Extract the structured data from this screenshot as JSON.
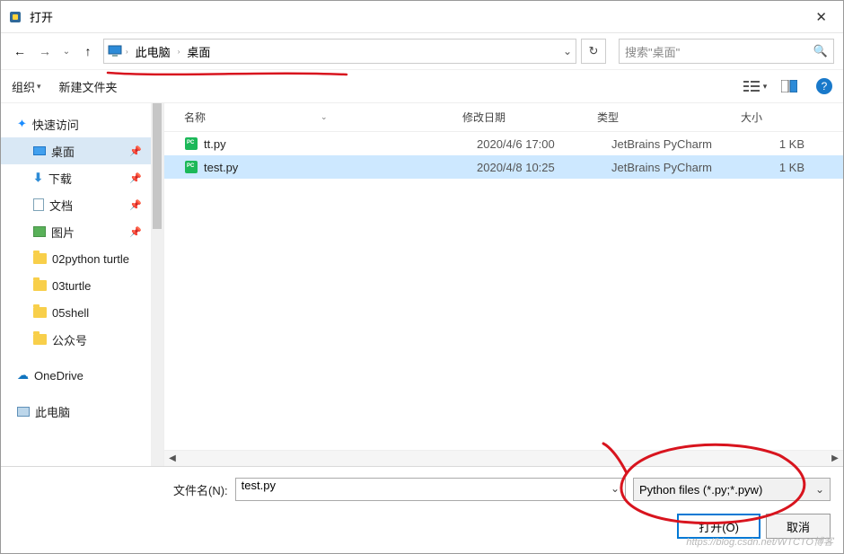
{
  "titlebar": {
    "title": "打开",
    "close_glyph": "✕"
  },
  "nav": {
    "back_glyph": "←",
    "fwd_glyph": "→",
    "up_glyph": "↑",
    "dropdown_glyph": "⌄",
    "refresh_glyph": "↻"
  },
  "breadcrumb": {
    "seg1": "此电脑",
    "seg2": "桌面",
    "sep_glyph": "›"
  },
  "search": {
    "placeholder": "搜索\"桌面\"",
    "mag_glyph": "🔍"
  },
  "toolbar": {
    "organize": "组织",
    "newfolder": "新建文件夹",
    "help_glyph": "?"
  },
  "sidebar": {
    "quick": "快速访问",
    "desktop": "桌面",
    "downloads": "下载",
    "documents": "文档",
    "pictures": "图片",
    "f1": "02python turtle",
    "f2": "03turtle",
    "f3": "05shell",
    "f4": "公众号",
    "onedrive": "OneDrive",
    "thispc": "此电脑",
    "pin_glyph": "📌"
  },
  "columns": {
    "name": "名称",
    "date": "修改日期",
    "type": "类型",
    "size": "大小"
  },
  "files": [
    {
      "name": "tt.py",
      "date": "2020/4/6 17:00",
      "type": "JetBrains PyCharm",
      "size": "1 KB"
    },
    {
      "name": "test.py",
      "date": "2020/4/8 10:25",
      "type": "JetBrains PyCharm",
      "size": "1 KB"
    }
  ],
  "footer": {
    "fname_label": "文件名(N):",
    "fname_value": "test.py",
    "ftype_value": "Python files (*.py;*.pyw)",
    "open_btn": "打开(O)",
    "cancel_btn": "取消"
  },
  "watermark": "https://blog.csdn.net/WTCTO博客"
}
